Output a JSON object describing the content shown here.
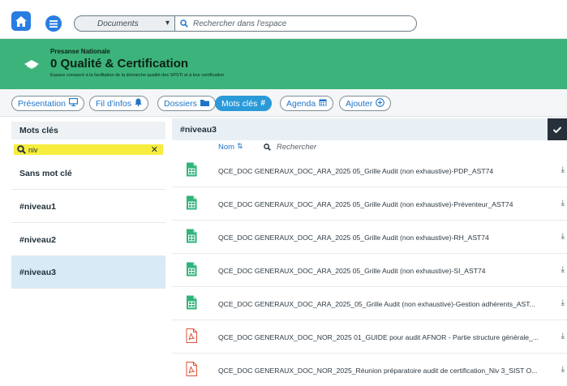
{
  "topbar": {
    "space_selector": "Documents",
    "search_placeholder": "Rechercher dans l'espace"
  },
  "banner": {
    "org": "Presanse Nationale",
    "title": "0 Qualité & Certification",
    "description": "Espace consacré à la facilitation de la démarche qualité des SPSTI et à leur certification",
    "color": "#3cb37a"
  },
  "nav": {
    "items": [
      {
        "label": "Présentation",
        "icon": "presentation-icon"
      },
      {
        "label": "Fil d'infos",
        "icon": "bell-icon"
      },
      {
        "label": "Dossiers",
        "icon": "folder-icon"
      },
      {
        "label": "Mots clés",
        "icon": "hashtag-icon",
        "active": true
      },
      {
        "label": "Agenda",
        "icon": "calendar-icon"
      },
      {
        "label": "Ajouter",
        "icon": "plus-circle-icon"
      }
    ],
    "active_color": "#2a9ad9"
  },
  "keywords": {
    "header": "Mots clés",
    "filter_value": "niv",
    "items": [
      {
        "label": "Sans mot clé"
      },
      {
        "label": "#niveau1"
      },
      {
        "label": "#niveau2"
      },
      {
        "label": "#niveau3",
        "selected": true
      }
    ]
  },
  "main": {
    "header": "#niveau3",
    "sort_label": "Nom",
    "search_placeholder": "Rechercher",
    "files": [
      {
        "name": "QCE_DOC GENERAUX_DOC_ARA_2025 05_Grille Audit (non exhaustive)-PDP_AST74",
        "type": "spreadsheet"
      },
      {
        "name": "QCE_DOC GENERAUX_DOC_ARA_2025 05_Grille Audit (non exhaustive)-Préventeur_AST74",
        "type": "spreadsheet"
      },
      {
        "name": "QCE_DOC GENERAUX_DOC_ARA_2025 05_Grille Audit (non exhaustive)-RH_AST74",
        "type": "spreadsheet"
      },
      {
        "name": "QCE_DOC GENERAUX_DOC_ARA_2025 05_Grille Audit (non exhaustive)-SI_AST74",
        "type": "spreadsheet"
      },
      {
        "name": "QCE_DOC GENERAUX_DOC_ARA_2025_05_Grille Audit (non exhaustive)-Gestion adhérents_AST...",
        "type": "spreadsheet"
      },
      {
        "name": "QCE_DOC GENERAUX_DOC_NOR_2025 01_GUIDE pour audit AFNOR - Partie structure générale_...",
        "type": "pdf"
      },
      {
        "name": "QCE_DOC GENERAUX_DOC_NOR_2025_Réunion préparatoire audit de certification_Niv 3_SIST O...",
        "type": "pdf"
      }
    ]
  }
}
